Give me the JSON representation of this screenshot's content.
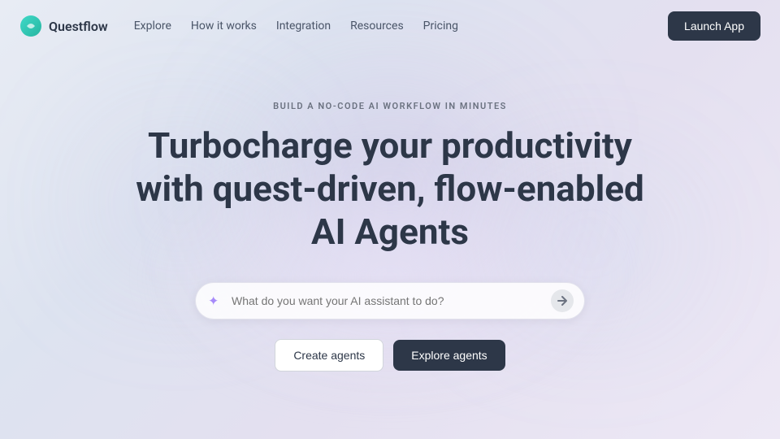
{
  "nav": {
    "logo_text": "Questflow",
    "links": [
      {
        "label": "Explore",
        "id": "explore"
      },
      {
        "label": "How it works",
        "id": "how-it-works"
      },
      {
        "label": "Integration",
        "id": "integration"
      },
      {
        "label": "Resources",
        "id": "resources"
      },
      {
        "label": "Pricing",
        "id": "pricing"
      }
    ],
    "launch_button": "Launch App"
  },
  "hero": {
    "eyebrow": "BUILD A NO-CODE AI WORKFLOW IN MINUTES",
    "title_line1": "Turbocharge your productivity",
    "title_line2": "with quest-driven, flow-enabled",
    "title_line3": "AI Agents",
    "search_placeholder": "What do you want your AI assistant to do?",
    "create_button": "Create agents",
    "explore_button": "Explore agents"
  }
}
